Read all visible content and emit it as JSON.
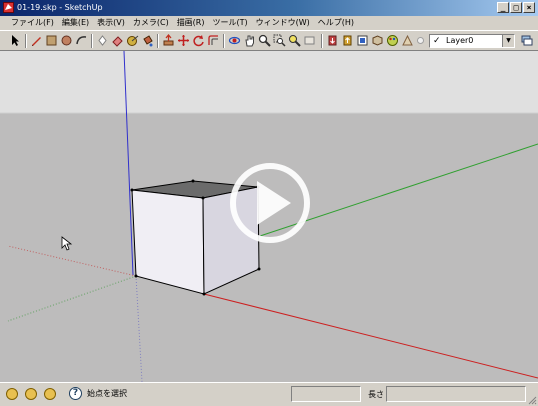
{
  "window": {
    "title": "01-19.skp - SketchUp",
    "buttons": {
      "minimize": "_",
      "maximize": "□",
      "close": "×"
    }
  },
  "menu": [
    {
      "label": "ファイル(F)"
    },
    {
      "label": "編集(E)"
    },
    {
      "label": "表示(V)"
    },
    {
      "label": "カメラ(C)"
    },
    {
      "label": "描画(R)"
    },
    {
      "label": "ツール(T)"
    },
    {
      "label": "ウィンドウ(W)"
    },
    {
      "label": "ヘルプ(H)"
    }
  ],
  "toolbar": {
    "layer": {
      "check": "✓",
      "value": "Layer0",
      "dropdown_icon": "chevron-down-icon"
    }
  },
  "statusbar": {
    "status": "始点を選択",
    "measurement_label": "長さ",
    "help_symbol": "?"
  },
  "colors": {
    "axis_red": "#cc2020",
    "axis_green": "#30a030",
    "axis_blue": "#3030cc",
    "ground": "#bdbcbc",
    "sky": "#e0e0e0",
    "title_start": "#0a246a"
  }
}
